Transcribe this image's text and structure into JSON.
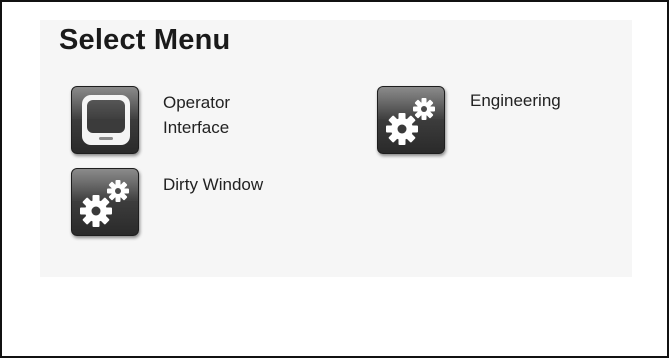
{
  "screen": {
    "title": "Select Menu"
  },
  "menu": {
    "items": [
      {
        "id": "operator-interface",
        "label_line1": "Operator",
        "label_line2": "Interface",
        "icon": "monitor-icon"
      },
      {
        "id": "engineering",
        "label": "Engineering",
        "icon": "gears-icon"
      },
      {
        "id": "dirty-window",
        "label": "Dirty Window",
        "icon": "gears-icon"
      }
    ]
  },
  "colors": {
    "icon_background": "#3e3e3e",
    "icon_glyph": "#ffffff",
    "panel_background": "#f6f6f6",
    "text": "#222222"
  }
}
